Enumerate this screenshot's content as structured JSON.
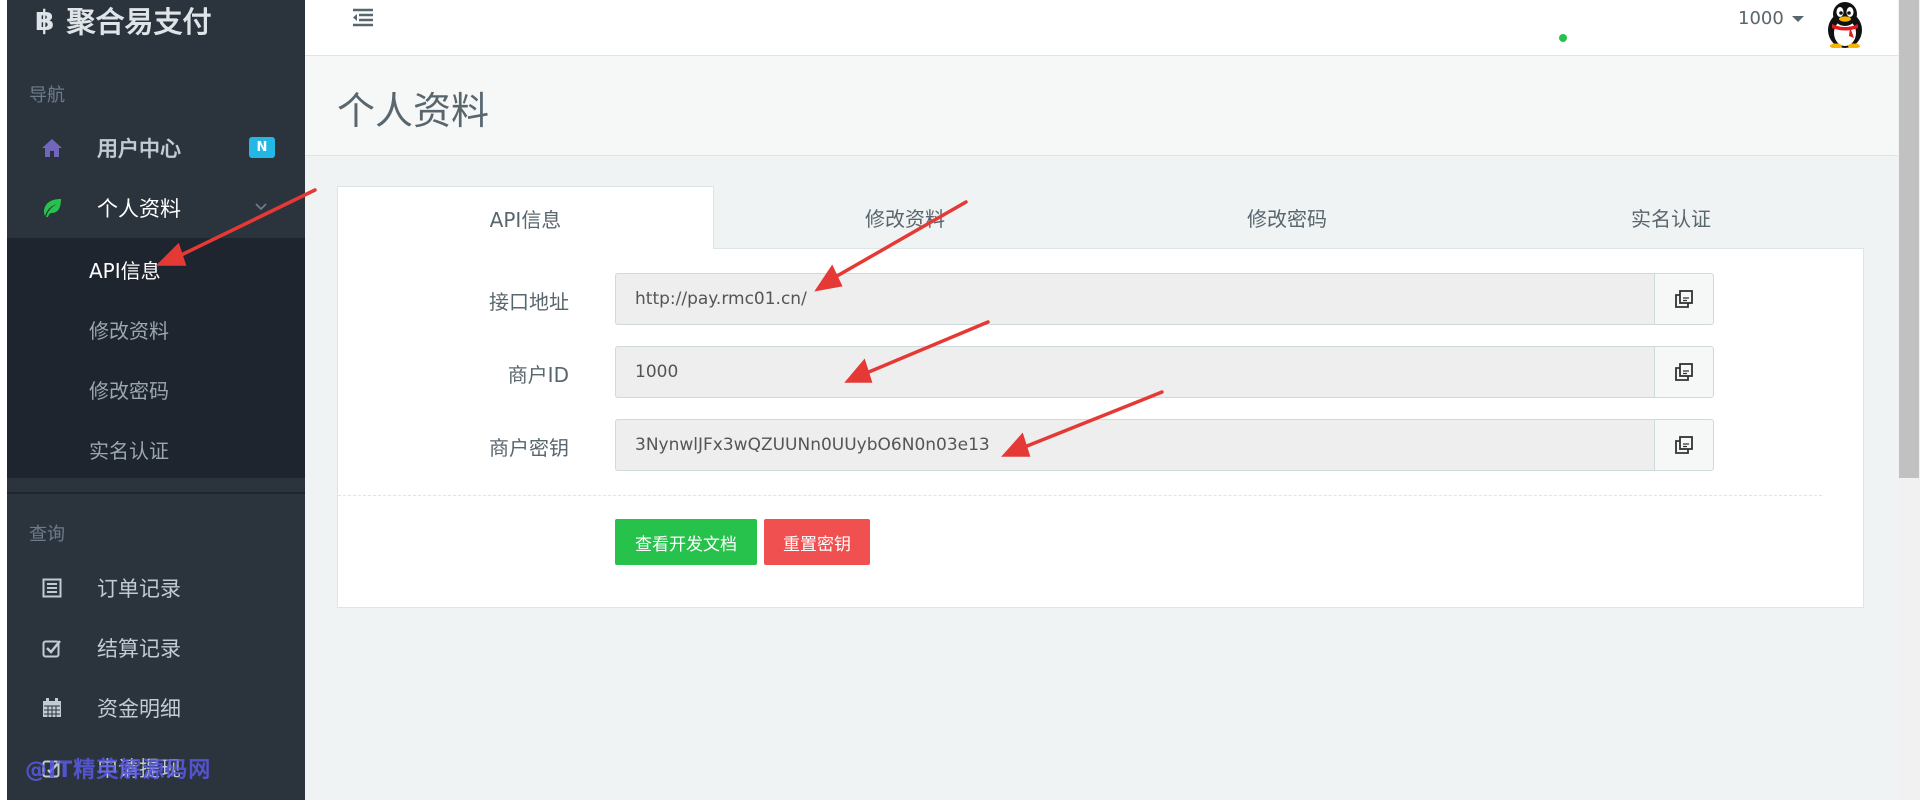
{
  "app": {
    "brand_logo": "฿",
    "brand_name": "聚合易支付"
  },
  "sidebar": {
    "nav_header": "导航",
    "query_header": "查询",
    "items": [
      {
        "label": "用户中心",
        "icon": "home-icon",
        "badge": "N"
      },
      {
        "label": "个人资料",
        "icon": "leaf-icon",
        "expanded": true
      },
      {
        "label": "订单记录",
        "icon": "list-icon"
      },
      {
        "label": "结算记录",
        "icon": "check-square-icon"
      },
      {
        "label": "资金明细",
        "icon": "calendar-icon"
      },
      {
        "label": "申请提现",
        "icon": "edit-icon"
      }
    ],
    "submenu": [
      {
        "label": "API信息",
        "current": true
      },
      {
        "label": "修改资料"
      },
      {
        "label": "修改密码"
      },
      {
        "label": "实名认证"
      }
    ],
    "watermark": "@IT精英解源码网"
  },
  "header": {
    "user_id": "1000",
    "avatar": "qq-penguin-avatar"
  },
  "page": {
    "title": "个人资料",
    "tabs": [
      "API信息",
      "修改资料",
      "修改密码",
      "实名认证"
    ],
    "active_tab": 0,
    "fields": [
      {
        "label": "接口地址",
        "value": "http://pay.rmc01.cn/"
      },
      {
        "label": "商户ID",
        "value": "1000"
      },
      {
        "label": "商户密钥",
        "value": "3NynwlJFx3wQZUUNn0UUybO6N0n03e13"
      }
    ],
    "buttons": {
      "docs": "查看开发文档",
      "reset": "重置密钥"
    }
  },
  "colors": {
    "sidebar_bg": "#2b333d",
    "submenu_bg": "#1e252e",
    "accent_badge": "#23b7e5",
    "success": "#27c24c",
    "danger": "#f05050",
    "annotation_arrow": "#e53935"
  }
}
